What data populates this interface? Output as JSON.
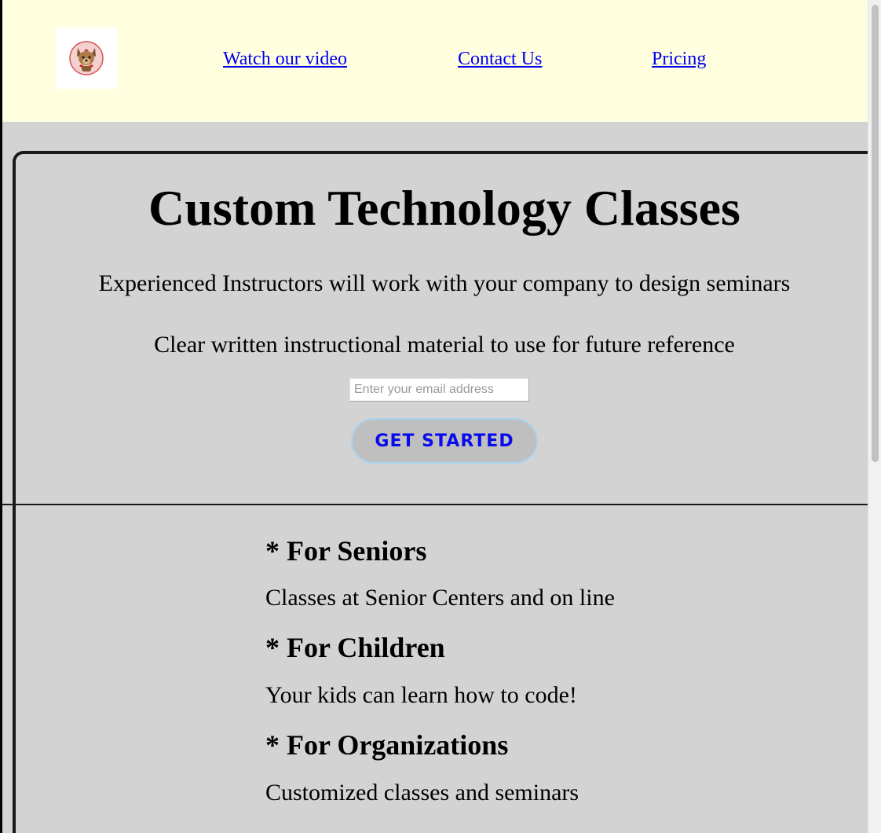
{
  "header": {
    "logo_icon": "dog-logo-icon",
    "nav": {
      "video": "Watch our video",
      "contact": "Contact Us",
      "pricing": "Pricing"
    }
  },
  "hero": {
    "title": "Custom Technology Classes",
    "line1": "Experienced Instructors will work with your company to design seminars",
    "line2": "Clear written instructional material to use for future reference",
    "email_placeholder": "Enter your email address",
    "button_label": "GET STARTED"
  },
  "features": [
    {
      "heading": "* For Seniors",
      "text": "Classes at Senior Centers and on line"
    },
    {
      "heading": "* For Children",
      "text": "Your kids can learn how to code!"
    },
    {
      "heading": "* For Organizations",
      "text": "Customized classes and seminars"
    }
  ],
  "colors": {
    "header_bg": "#ffffe0",
    "page_bg": "#d3d3d3",
    "link": "#0000ee",
    "button_text": "#0a0aee",
    "button_border": "#a8d4f2"
  }
}
